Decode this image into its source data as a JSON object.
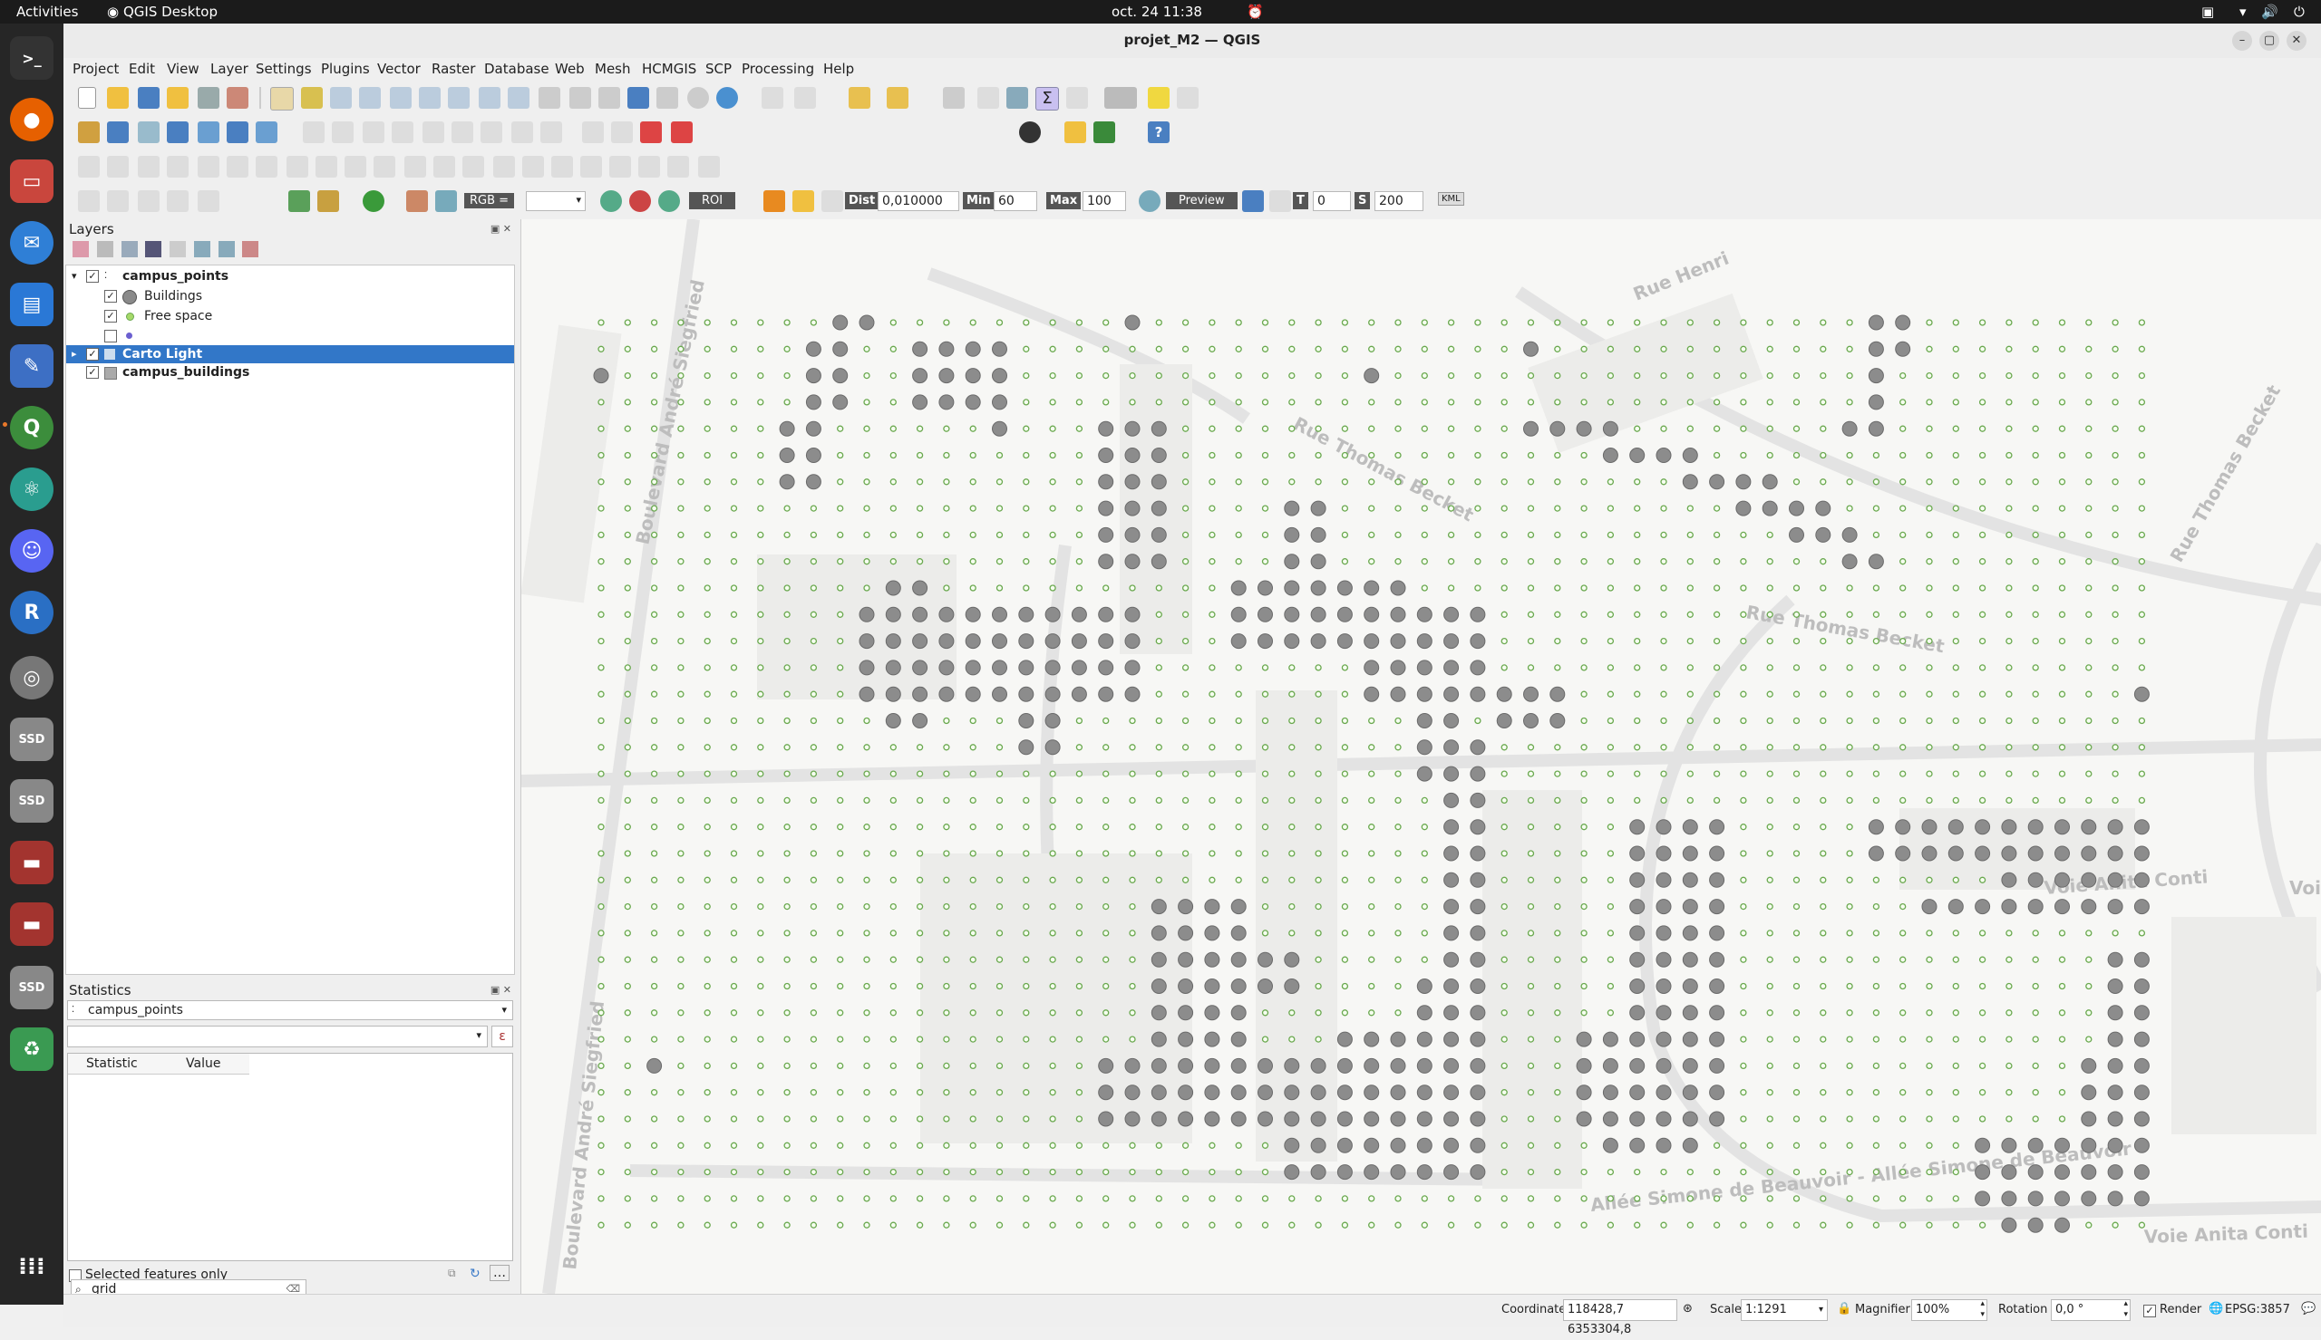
{
  "topbar": {
    "activities": "Activities",
    "app_name": "QGIS Desktop",
    "datetime": "oct. 24  11:38"
  },
  "window": {
    "title": "projet_M2 — QGIS"
  },
  "menu": [
    "Project",
    "Edit",
    "View",
    "Layer",
    "Settings",
    "Plugins",
    "Vector",
    "Raster",
    "Database",
    "Web",
    "Mesh",
    "HCMGIS",
    "SCP",
    "Processing",
    "Help"
  ],
  "scp_toolbar": {
    "rgb_label": "RGB =",
    "roi_label": "ROI",
    "dist_label": "Dist",
    "dist_value": "0,010000",
    "min_label": "Min",
    "min_value": "60",
    "max_label": "Max",
    "max_value": "100",
    "preview_label": "Preview",
    "t_label": "T",
    "t_value": "0",
    "s_label": "S",
    "s_value": "200",
    "kml_label": "KML"
  },
  "layers_panel": {
    "title": "Layers",
    "layers": [
      {
        "name": "campus_points",
        "checked": true,
        "bold": true
      },
      {
        "name": "Buildings",
        "checked": true,
        "symbol_color": "#8a8a8a"
      },
      {
        "name": "Free space",
        "checked": true,
        "symbol_color": "#a6d96a"
      },
      {
        "name": "",
        "checked": false,
        "symbol_color": "#6b5fd0"
      },
      {
        "name": "Carto Light",
        "checked": true,
        "selected": true,
        "bold": true
      },
      {
        "name": "campus_buildings",
        "checked": true,
        "bold": true
      }
    ]
  },
  "stats_panel": {
    "title": "Statistics",
    "layer_value": "campus_points",
    "columns": [
      "Statistic",
      "Value"
    ],
    "selected_only_label": "Selected features only"
  },
  "locator": {
    "value": "grid"
  },
  "statusbar": {
    "coordinate_label": "Coordinate",
    "coordinate_value": "118428,7  6353304,8",
    "scale_label": "Scale",
    "scale_value": "1:1291",
    "magnifier_label": "Magnifier",
    "magnifier_value": "100%",
    "rotation_label": "Rotation",
    "rotation_value": "0,0 °",
    "render_label": "Render",
    "crs_label": "EPSG:3857"
  },
  "map": {
    "street_labels": [
      {
        "text": "Boulevard André Siegfried"
      },
      {
        "text": "Boulevard André Siegfried"
      },
      {
        "text": "Rue Thomas Becket"
      },
      {
        "text": "Rue Thomas Becket"
      },
      {
        "text": "Rue Thomas Becket"
      },
      {
        "text": "Rue Henri"
      },
      {
        "text": "Voie Anita Conti"
      },
      {
        "text": "Voie Anita Conti"
      },
      {
        "text": "Voie Anita Conti"
      },
      {
        "text": "Allée Simone de Beauvoir - Allée Simone de Beauvoir"
      }
    ],
    "colors": {
      "building_point": "#8c8c8c",
      "free_point_stroke": "#6aa84f",
      "free_point_fill": "#f6fff0",
      "basemap_bg": "#f7f7f5",
      "basemap_road": "#e0e0e0"
    }
  }
}
